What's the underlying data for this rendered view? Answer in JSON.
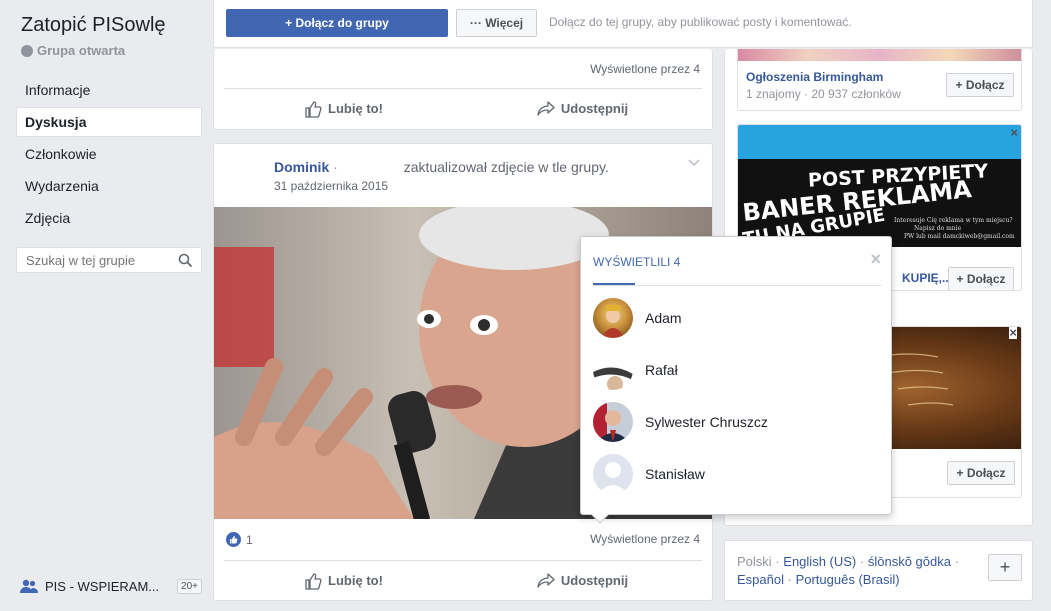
{
  "group": {
    "title": "Zatopić PISowlę",
    "privacy": "Grupa otwarta"
  },
  "nav": {
    "items": [
      {
        "label": "Informacje"
      },
      {
        "label": "Dyskusja"
      },
      {
        "label": "Członkowie"
      },
      {
        "label": "Wydarzenia"
      },
      {
        "label": "Zdjęcia"
      }
    ],
    "search_placeholder": "Szukaj w tej grupie"
  },
  "chat": {
    "label": "PIS - WSPIERAM...",
    "badge": "20+"
  },
  "topbar": {
    "join_label": "+ Dołącz do grupy",
    "more_label": "··· Więcej",
    "hint": "Dołącz do tej grupy, aby publikować posty i komentować."
  },
  "post1": {
    "seen": "Wyświetlone przez 4",
    "like": "Lubię to!",
    "share": "Udostępnij"
  },
  "post2": {
    "author": "Dominik",
    "dot": "·",
    "action": "zaktualizował zdjęcie w tle grupy.",
    "date": "31 października 2015",
    "reactions": "1",
    "seen": "Wyświetlone przez 4",
    "like": "Lubię to!",
    "share": "Udostępnij"
  },
  "popup": {
    "title": "WYŚWIETLILI 4",
    "close": "×",
    "viewers": [
      {
        "name": "Adam"
      },
      {
        "name": "Rafał"
      },
      {
        "name": "Sylwester Chruszcz"
      },
      {
        "name": "Stanisław"
      }
    ]
  },
  "sidebar": {
    "group1": {
      "name": "Ogłoszenia Birmingham",
      "meta": "1 znajomy · 20 937 członków",
      "join": "+ Dołącz"
    },
    "ad": {
      "line1": "POST PRZYPIETY",
      "line2": "BANER  REKLAMA",
      "line3": "TU NA GRUPIE",
      "small1": "Interesuje Cię reklama w tym miejscu?",
      "small2": "Napisz do mnie",
      "small3": "PW lub mail damckiweb@gmail.com",
      "name": "KUPIĘ,...",
      "join": "+ Dołącz",
      "close": "×"
    },
    "group3": {
      "join": "+ Dołącz",
      "close": "×"
    }
  },
  "footer": {
    "current": "Polski",
    "languages": [
      "English (US)",
      "ślōnskŏ gŏdka",
      "Español",
      "Português (Brasil)"
    ],
    "sep": "·",
    "add": "+"
  },
  "colors": {
    "fb_blue": "#4267b2",
    "link": "#365899",
    "background": "#e9ebee"
  }
}
